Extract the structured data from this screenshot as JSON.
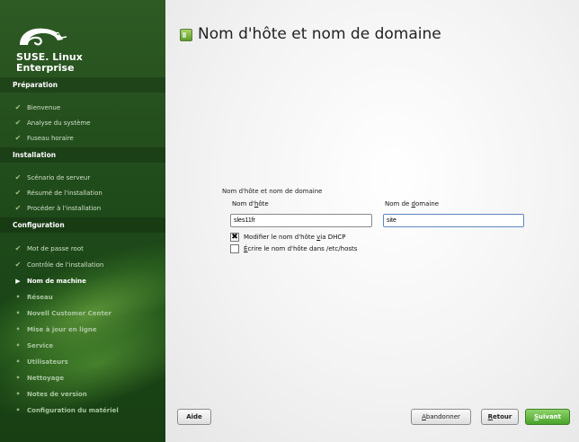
{
  "sidebar": {
    "brand_line1": "SUSE. Linux",
    "brand_line2": "Enterprise",
    "sections": [
      {
        "title": "Préparation"
      },
      {
        "title": "Installation"
      },
      {
        "title": "Configuration"
      }
    ],
    "steps": [
      {
        "label": "Bienvenue",
        "state": "done"
      },
      {
        "label": "Analyse du système",
        "state": "done"
      },
      {
        "label": "Fuseau horaire",
        "state": "done"
      },
      {
        "label": "Scénario de serveur",
        "state": "done"
      },
      {
        "label": "Résumé de l'installation",
        "state": "done"
      },
      {
        "label": "Procéder à l'installation",
        "state": "done"
      },
      {
        "label": "Mot de passe root",
        "state": "done"
      },
      {
        "label": "Contrôle de l'installation",
        "state": "done"
      },
      {
        "label": "Nom de machine",
        "state": "current"
      },
      {
        "label": "Réseau",
        "state": "todo"
      },
      {
        "label": "Novell Customer Center",
        "state": "todo"
      },
      {
        "label": "Mise à jour en ligne",
        "state": "todo"
      },
      {
        "label": "Service",
        "state": "todo"
      },
      {
        "label": "Utilisateurs",
        "state": "todo"
      },
      {
        "label": "Nettoyage",
        "state": "todo"
      },
      {
        "label": "Notes de version",
        "state": "todo"
      },
      {
        "label": "Configuration du matériel",
        "state": "todo"
      }
    ],
    "icons": {
      "done": "check-icon",
      "current": "arrow-right-icon",
      "todo": "bullet-icon"
    }
  },
  "main": {
    "title": "Nom d'hôte et nom de domaine",
    "title_icon": "network-card-icon",
    "group_label": "Nom d'hôte et nom de domaine",
    "hostname": {
      "label_pre": "Nom d'",
      "label_u": "h",
      "label_post": "ôte",
      "value": "sles11fr"
    },
    "domain": {
      "label_pre": "Nom de ",
      "label_u": "d",
      "label_post": "omaine",
      "value": "site"
    },
    "dhcp": {
      "checked": true,
      "label_pre": "Modifier le nom d'hôte ",
      "label_u": "v",
      "label_post": "ia DHCP"
    },
    "etchosts": {
      "checked": false,
      "label_pre": "",
      "label_u": "É",
      "label_post": "crire le nom d'hôte dans /etc/hosts"
    }
  },
  "buttons": {
    "help": "Aide",
    "abort_u": "A",
    "abort_rest": "bandonner",
    "back_u": "R",
    "back_rest": "etour",
    "next_u": "S",
    "next_rest": "uivant"
  },
  "colors": {
    "sidebar_bg": "#1f4a1a",
    "next_button": "#4aa22a",
    "title_text": "#222222"
  }
}
